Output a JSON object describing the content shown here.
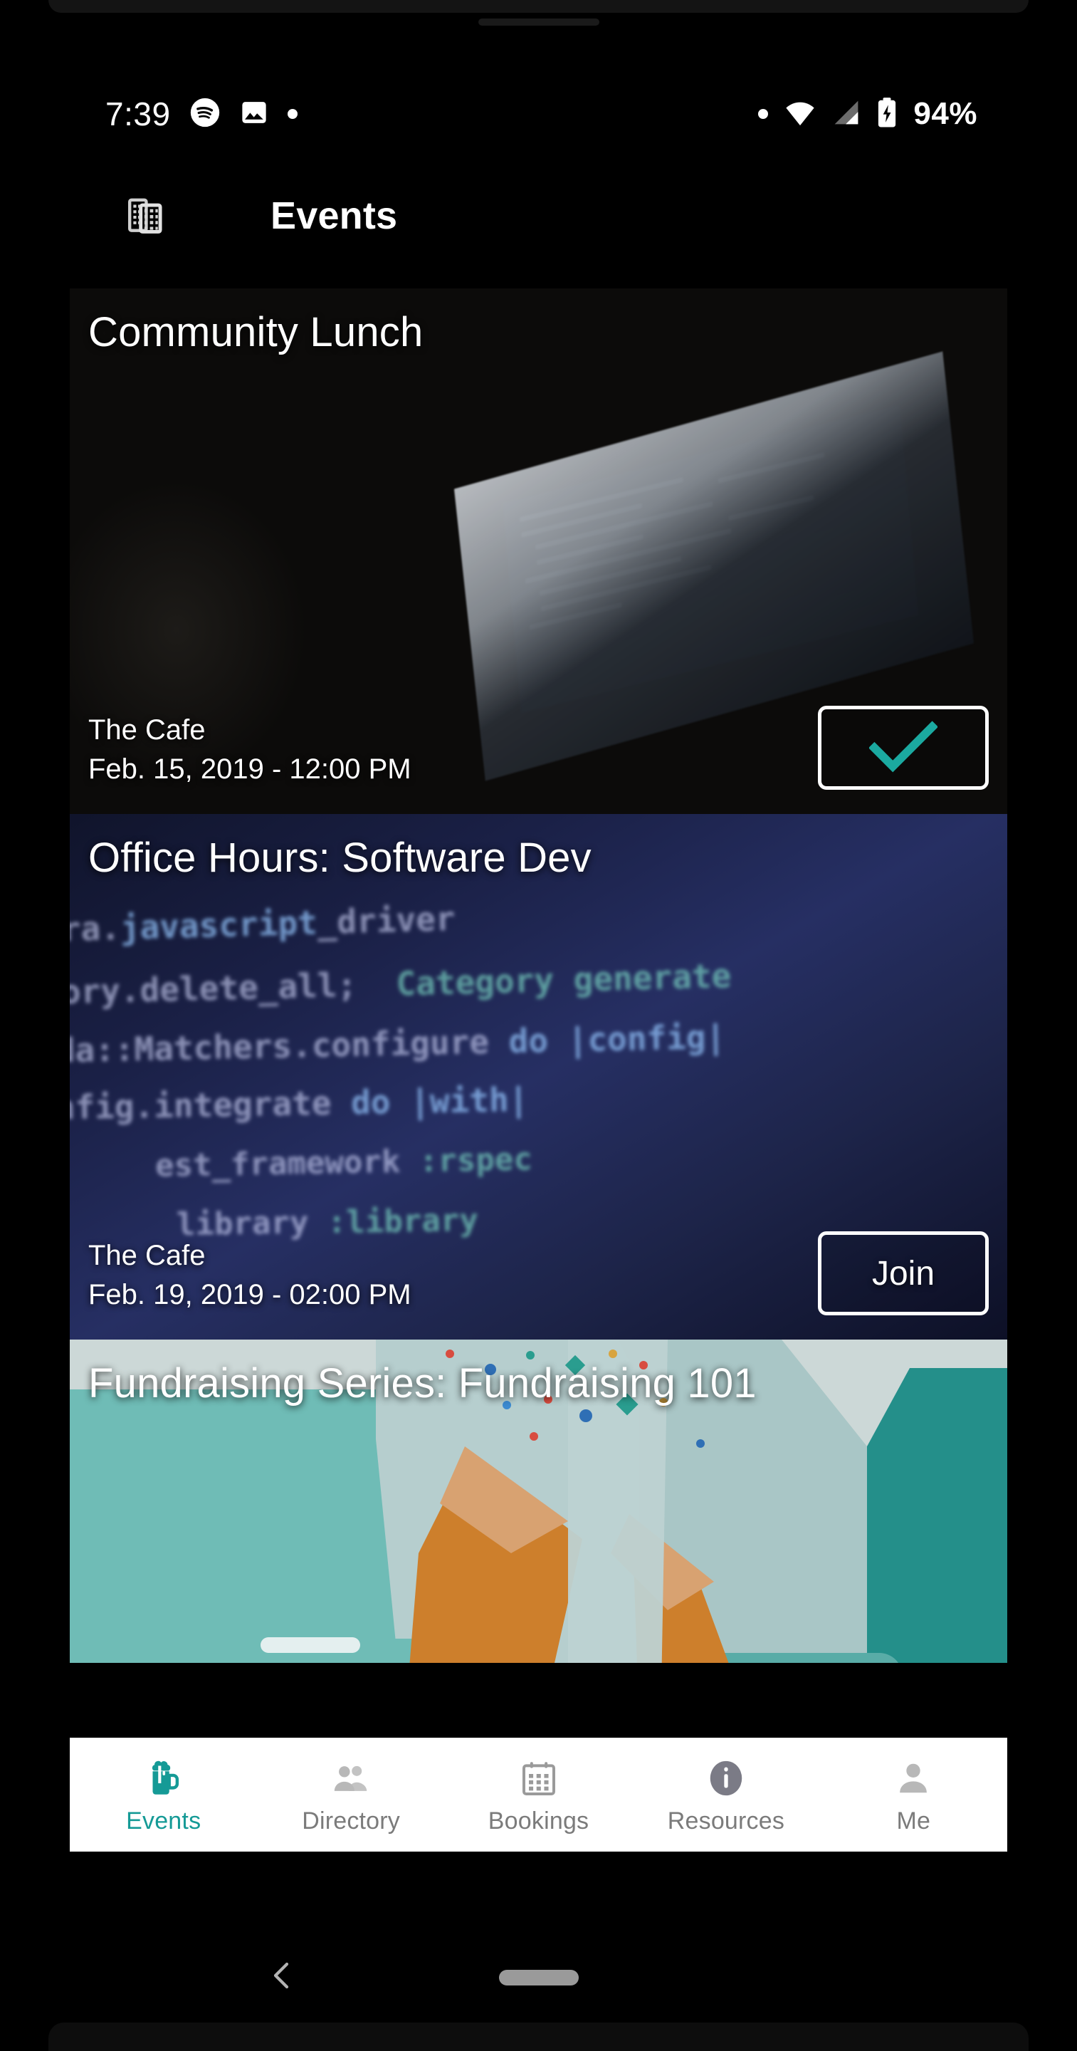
{
  "status_bar": {
    "time": "7:39",
    "battery_percent": "94%",
    "icons": [
      "spotify-icon",
      "image-icon",
      "dot-icon",
      "dot-icon",
      "wifi-icon",
      "cellular-signal-icon",
      "battery-charging-icon"
    ]
  },
  "app_bar": {
    "title": "Events",
    "icon": "buildings-icon"
  },
  "events": [
    {
      "title": "Community Lunch",
      "venue": "The Cafe",
      "date": "Feb. 15, 2019 - 12:00 PM",
      "action_label": "",
      "action_icon": "check-icon",
      "joined": true
    },
    {
      "title": "Office Hours: Software Dev",
      "venue": "The Cafe",
      "date": "Feb. 19, 2019 - 02:00 PM",
      "action_label": "Join",
      "action_icon": "",
      "joined": false
    },
    {
      "title": "Fundraising  Series: Fundraising 101",
      "venue": "",
      "date": "",
      "action_label": "",
      "action_icon": "",
      "joined": false
    }
  ],
  "bottom_nav": {
    "active_index": 0,
    "items": [
      {
        "label": "Events",
        "icon": "beer-mug-icon"
      },
      {
        "label": "Directory",
        "icon": "people-icon"
      },
      {
        "label": "Bookings",
        "icon": "calendar-icon"
      },
      {
        "label": "Resources",
        "icon": "info-circle-icon"
      },
      {
        "label": "Me",
        "icon": "person-icon"
      }
    ]
  },
  "system_nav": {
    "back_icon": "chevron-left-icon",
    "home_pill": "home-pill-handle"
  },
  "colors": {
    "accent_teal": "#159a96",
    "check_teal": "#1ba9a0",
    "nav_idle_gray": "#7b7b7b",
    "nav_bg": "#ffffff",
    "screen_bg": "#000000"
  },
  "code_background_text": [
    "ara.javascript_driver",
    "gory.delete_all;  Category generate",
    "lda::Matchers.configure do |config|",
    "onfig.integrate do |with|",
    "with.test_framework :rspec",
    "with.library :library"
  ]
}
